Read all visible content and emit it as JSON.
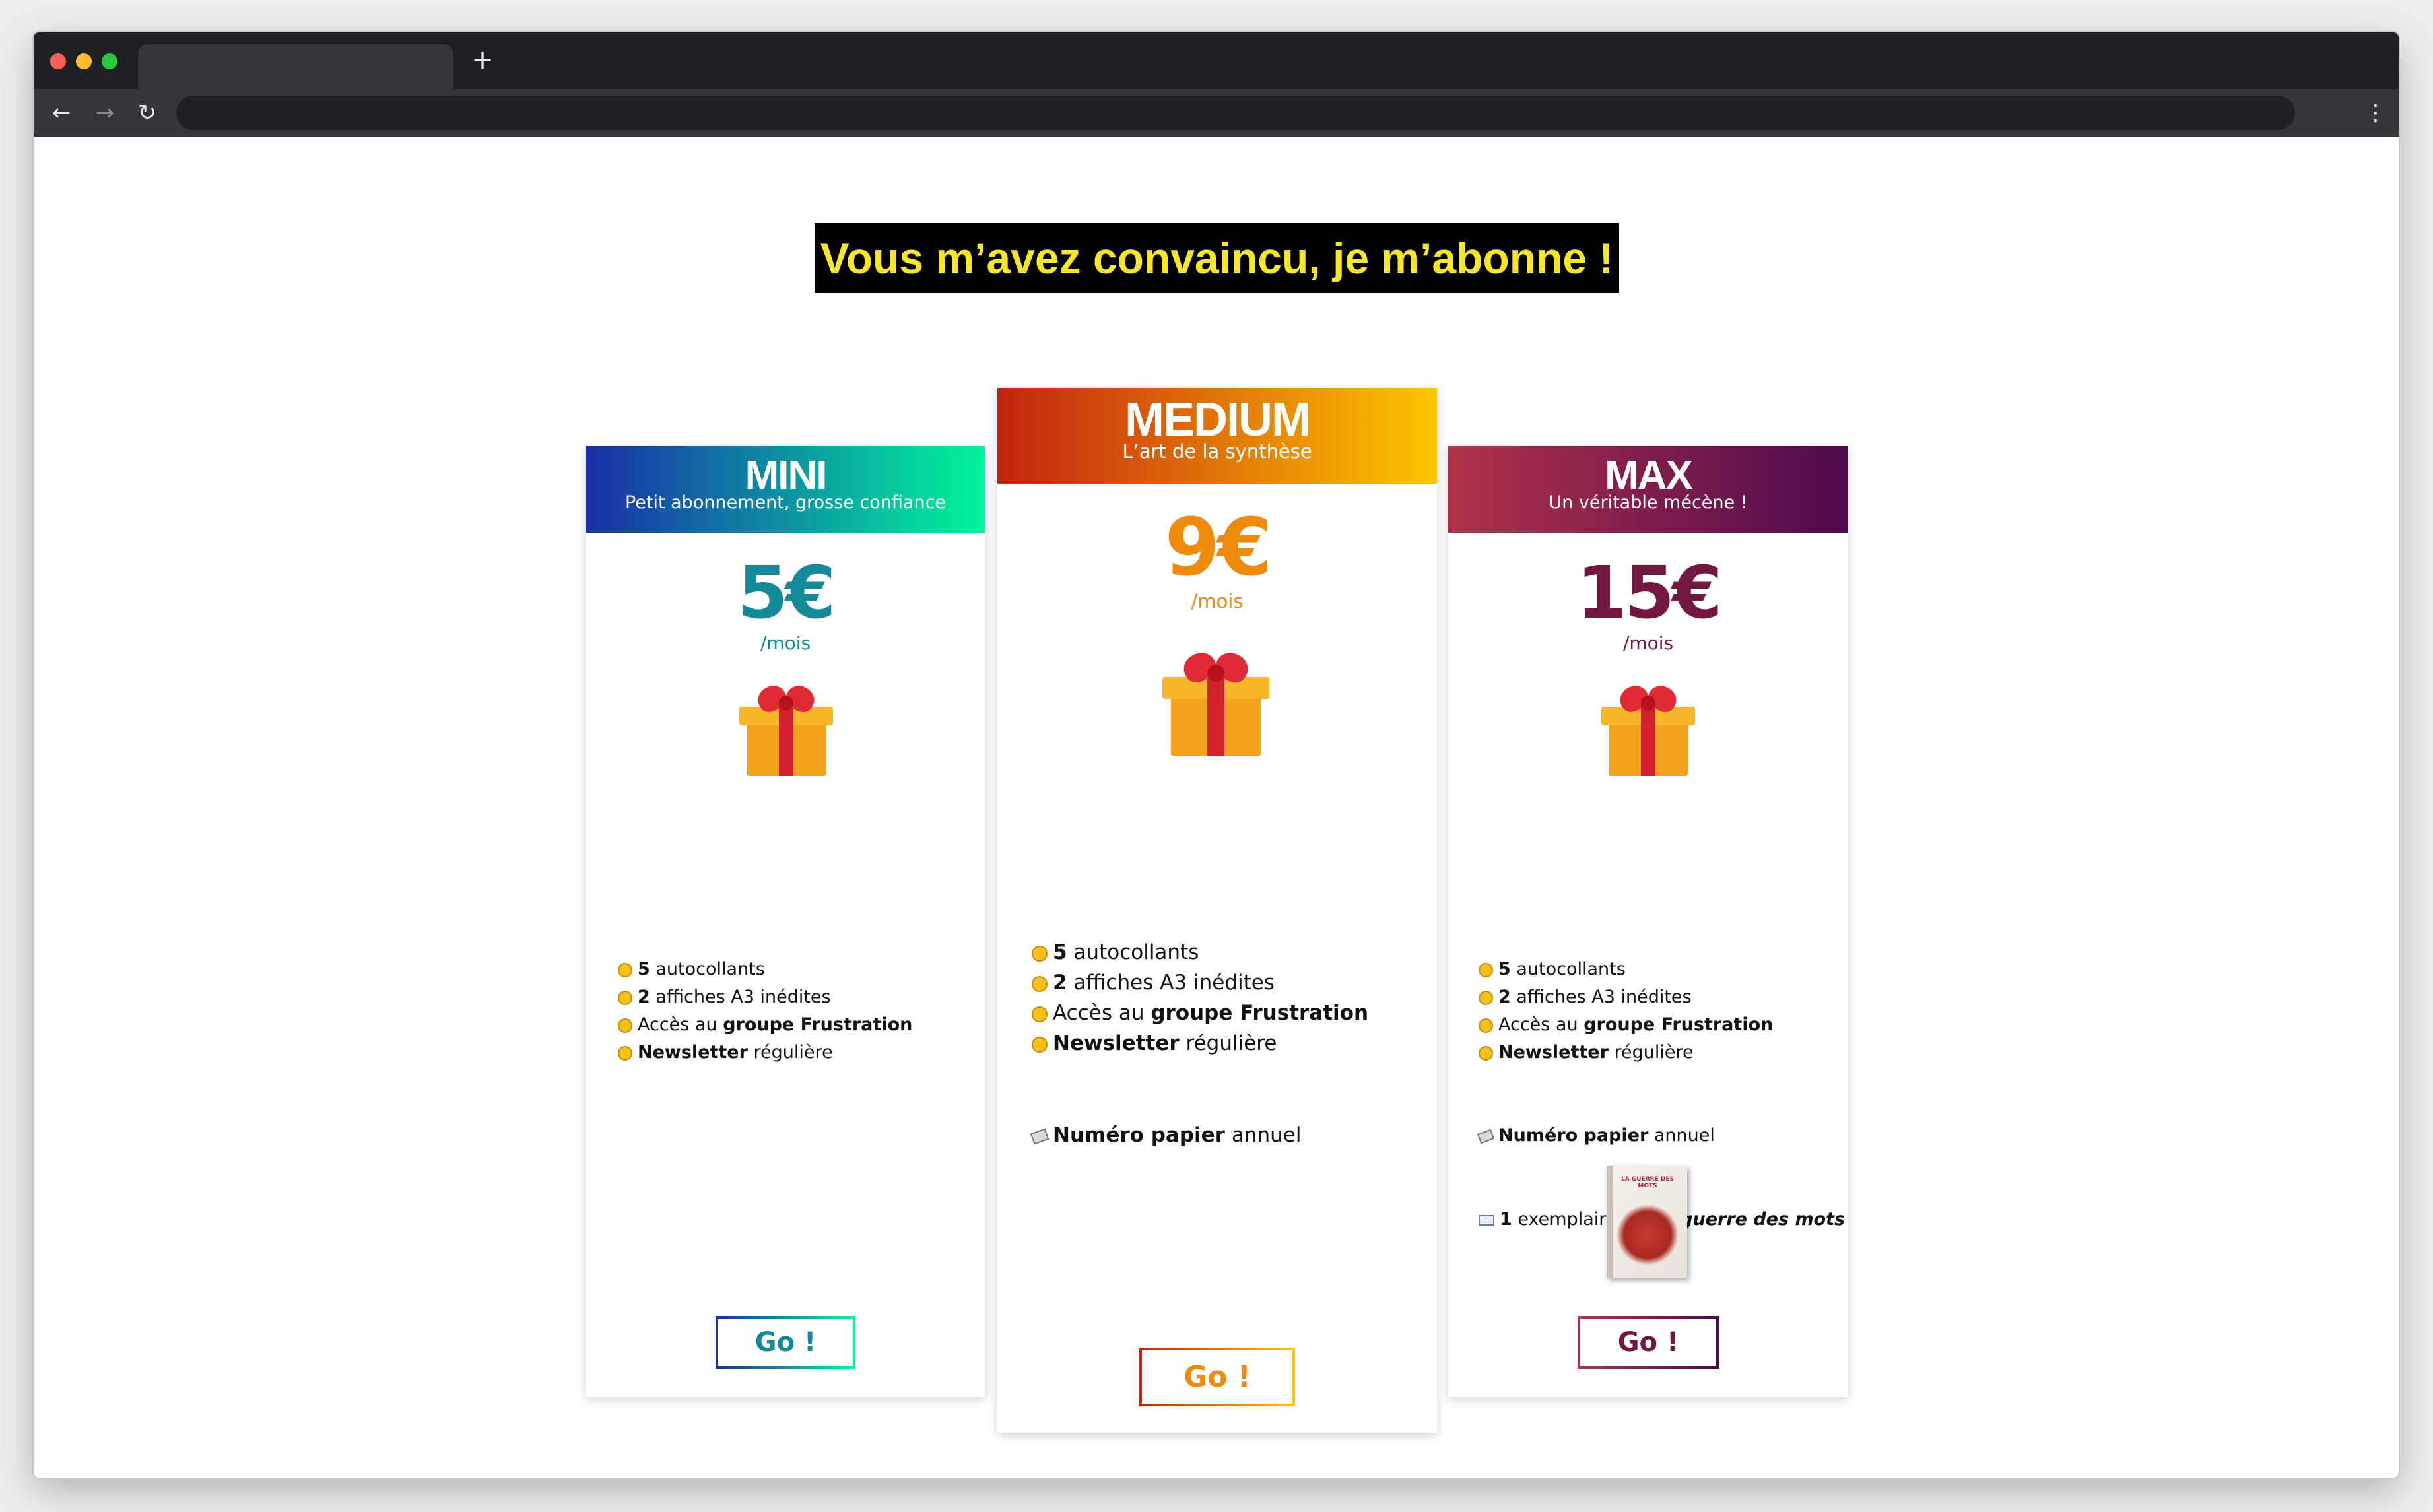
{
  "browser": {
    "tab_title": "",
    "new_tab_symbol": "+",
    "back_symbol": "←",
    "forward_symbol": "→",
    "reload_symbol": "↻",
    "menu_symbol": "⋮",
    "address": ""
  },
  "page": {
    "headline": "Vous m’avez convaincu, je m’abonne !"
  },
  "plans": [
    {
      "name": "MINI",
      "tagline": "Petit abonnement, grosse confiance",
      "price": "5€",
      "per": "/mois",
      "gradient": [
        "#1a2fa8",
        "#00f59a"
      ],
      "accent": "#13899a",
      "features": [
        {
          "bold": "5",
          "text": " autocollants"
        },
        {
          "bold": "2",
          "text": " affiches A3 inédites"
        },
        {
          "pre": "Accès au ",
          "bold": "groupe Frustration"
        },
        {
          "bold": "Newsletter",
          "text": " régulière"
        }
      ],
      "button": "Go !"
    },
    {
      "name": "MEDIUM",
      "tagline": "L’art de la synthèse",
      "price": "9€",
      "per": "/mois",
      "gradient": [
        "#c3230f",
        "#fdc600"
      ],
      "accent": "#f08a0c",
      "features": [
        {
          "bold": "5",
          "text": " autocollants"
        },
        {
          "bold": "2",
          "text": " affiches A3 inédites"
        },
        {
          "pre": "Accès au ",
          "bold": "groupe Frustration"
        },
        {
          "bold": "Newsletter",
          "text": " régulière"
        }
      ],
      "extra": {
        "bold": "Numéro papier",
        "text": " annuel"
      },
      "button": "Go !"
    },
    {
      "name": "MAX",
      "tagline": "Un véritable mécène !",
      "price": "15€",
      "per": "/mois",
      "gradient": [
        "#b0324a",
        "#4e0a4e"
      ],
      "accent": "#721840",
      "features": [
        {
          "bold": "5",
          "text": " autocollants"
        },
        {
          "bold": "2",
          "text": " affiches A3 inédites"
        },
        {
          "pre": "Accès au ",
          "bold": "groupe Frustration"
        },
        {
          "bold": "Newsletter",
          "text": " régulière"
        }
      ],
      "extra": {
        "bold": "Numéro papier",
        "text": " annuel"
      },
      "book": {
        "count": "1",
        "text": " exemplaire de ",
        "title": "La guerre des mots"
      },
      "book_cover_title": "LA GUERRE DES MOTS",
      "button": "Go !"
    }
  ]
}
